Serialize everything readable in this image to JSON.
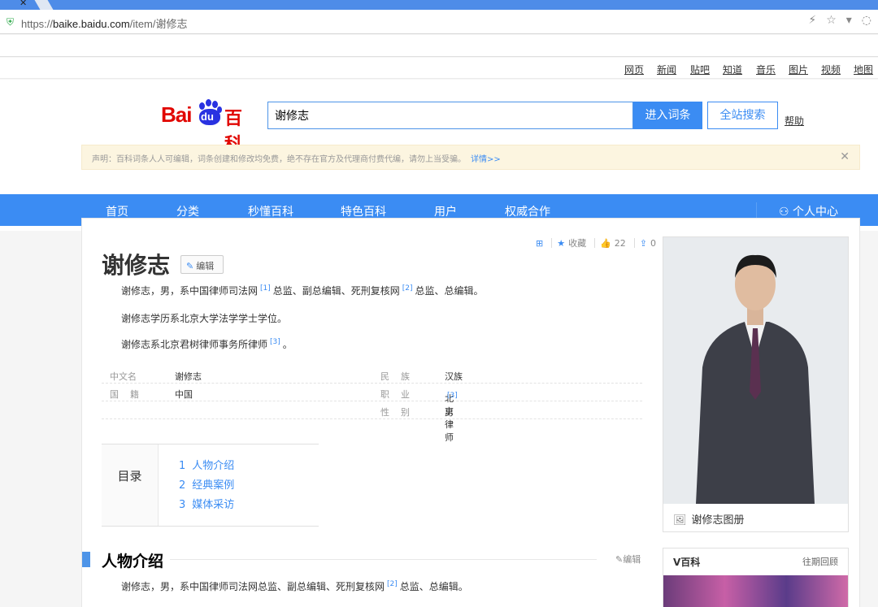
{
  "browser": {
    "url_prefix": "https://",
    "url_domain": "baike.baidu.com",
    "url_path": "/item/谢修志"
  },
  "topnav": [
    "网页",
    "新闻",
    "贴吧",
    "知道",
    "音乐",
    "图片",
    "视频",
    "地图"
  ],
  "logo": {
    "text1": "Bai",
    "text2": "du",
    "text3": "百科"
  },
  "search": {
    "value": "谢修志",
    "enter_label": "进入词条",
    "site_label": "全站搜索",
    "help_label": "帮助"
  },
  "notice": {
    "text": "声明：百科词条人人可编辑，词条创建和修改均免费，绝不存在官方及代理商付费代编，请勿上当受骗。",
    "more": "详情>>"
  },
  "mainnav": [
    "首页",
    "分类",
    "秒懂百科",
    "特色百科",
    "用户",
    "权威合作"
  ],
  "user_center": "个人中心",
  "tools": {
    "favorite": "收藏",
    "likes": "22",
    "shares": "0"
  },
  "entry": {
    "title": "谢修志",
    "edit_label": "编辑",
    "summary": [
      {
        "a": "谢修志，男，系中国律师司法网",
        "ref1": "[1]",
        "b": "总监、副总编辑、死刑复核网",
        "ref2": "[2]",
        "c": "总监、总编辑。"
      },
      {
        "a": "谢修志学历系北京大学法学学士学位。"
      },
      {
        "a": "谢修志系北京君树律师事务所律师",
        "ref1": "[3]",
        "b": "。"
      }
    ]
  },
  "infobox": [
    {
      "k1": "中文名",
      "v1": "谢修志",
      "k2": "民    族",
      "v2": "汉族"
    },
    {
      "k1": "国    籍",
      "v1": "中国",
      "k2": "职    业",
      "v2": "北京律师",
      "ref": "[3]"
    },
    {
      "k1": "",
      "v1": "",
      "k2": "性    别",
      "v2": "男"
    }
  ],
  "toc": {
    "label": "目录",
    "items": [
      {
        "num": "1",
        "label": "人物介绍"
      },
      {
        "num": "2",
        "label": "经典案例"
      },
      {
        "num": "3",
        "label": "媒体采访"
      }
    ]
  },
  "section": {
    "title": "人物介绍",
    "edit_label": "编辑",
    "para": {
      "a": "谢修志，男，系中国律师司法网总监、副总编辑、死刑复核网",
      "ref": "[2]",
      "b": "总监、总编辑。"
    }
  },
  "sidebar": {
    "album_label": "谢修志图册",
    "vbaike_title": "V百科",
    "vbaike_more": "往期回顾"
  }
}
